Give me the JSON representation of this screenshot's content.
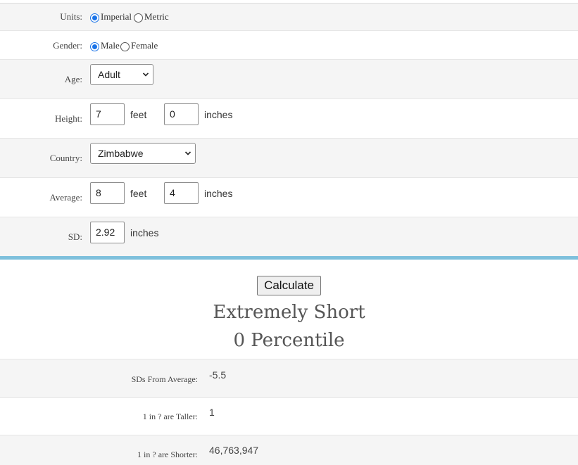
{
  "form": {
    "units": {
      "label": "Units:",
      "options": [
        "Imperial",
        "Metric"
      ],
      "selected": "Imperial"
    },
    "gender": {
      "label": "Gender:",
      "options": [
        "Male",
        "Female"
      ],
      "selected": "Male"
    },
    "age": {
      "label": "Age:",
      "value": "Adult"
    },
    "height": {
      "label": "Height:",
      "feet": "7",
      "feet_unit": "feet",
      "inches": "0",
      "inches_unit": "inches"
    },
    "country": {
      "label": "Country:",
      "value": "Zimbabwe"
    },
    "average": {
      "label": "Average:",
      "feet": "8",
      "feet_unit": "feet",
      "inches": "4",
      "inches_unit": "inches"
    },
    "sd": {
      "label": "SD:",
      "value": "2.92",
      "unit": "inches"
    }
  },
  "calculate_label": "Calculate",
  "result": {
    "category": "Extremely Short",
    "percentile": "0 Percentile"
  },
  "stats": [
    {
      "label": "SDs From Average:",
      "value": "-5.5"
    },
    {
      "label": "1 in ? are Taller:",
      "value": "1"
    },
    {
      "label": "1 in ? are Shorter:",
      "value": "46,763,947"
    }
  ],
  "colors": {
    "accent_bar": "#7ec0dc",
    "radio_selected": "#1a73e8",
    "row_alt": "#f5f5f5"
  },
  "icons": {
    "select_arrow": "chevron-down-icon"
  }
}
